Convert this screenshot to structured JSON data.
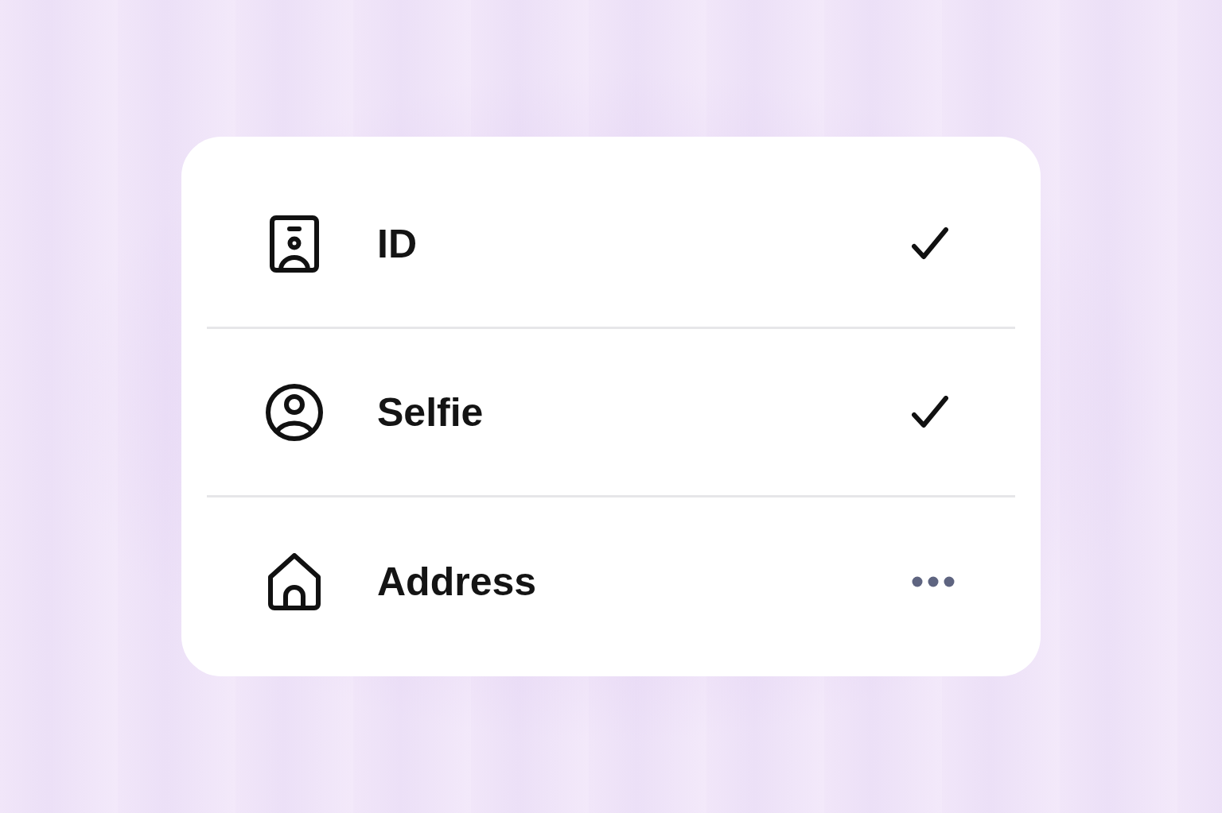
{
  "steps": [
    {
      "label": "ID",
      "complete": true
    },
    {
      "label": "Selfie",
      "complete": true
    },
    {
      "label": "Address",
      "complete": false
    }
  ]
}
